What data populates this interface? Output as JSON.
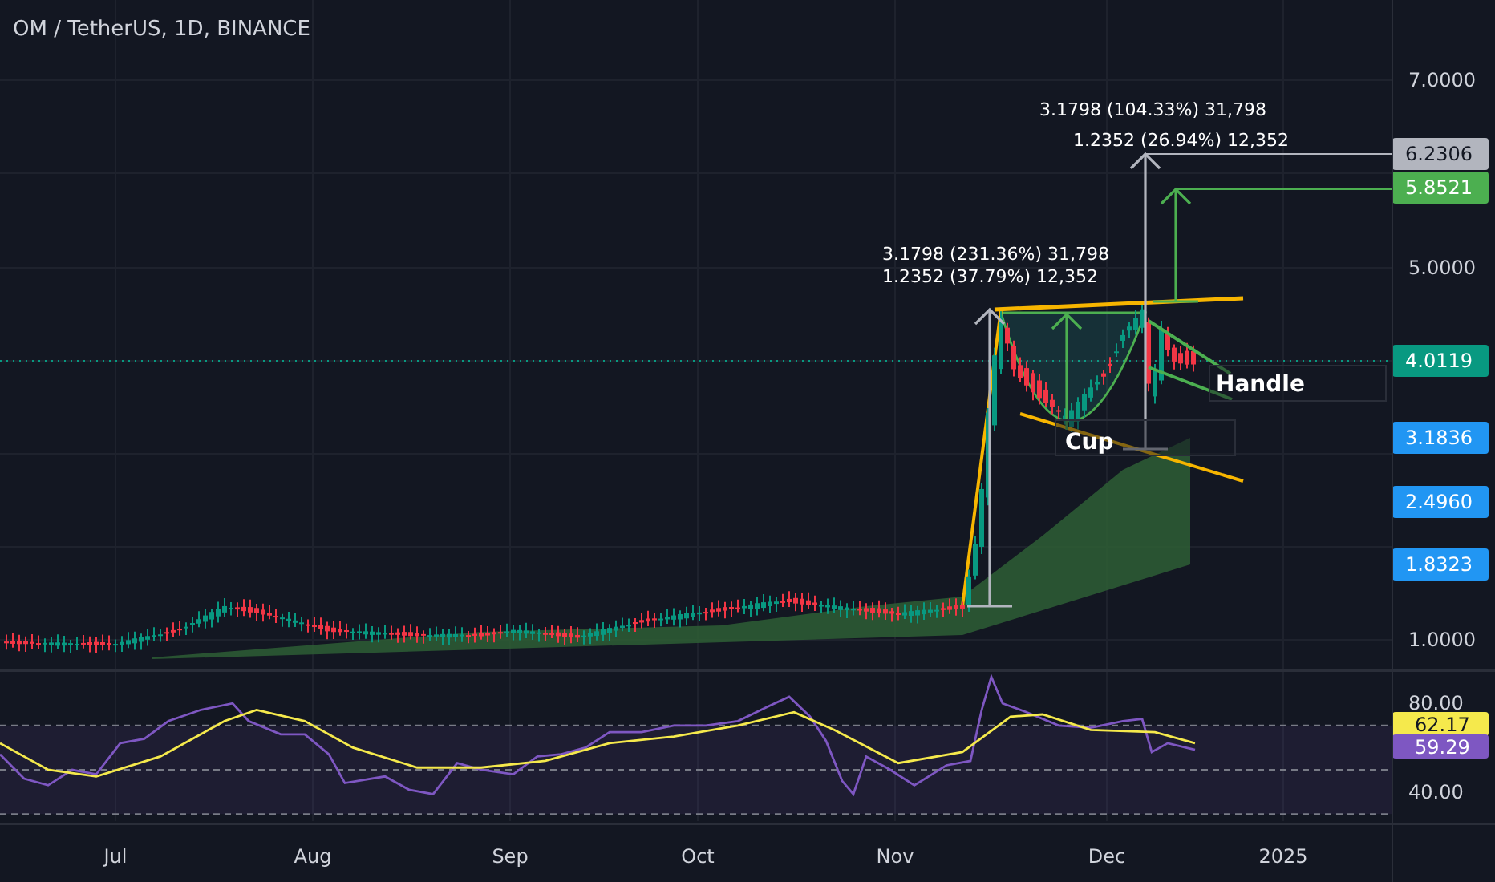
{
  "title": "OM / TetherUS, 1D, BINANCE",
  "price_axis": {
    "ticks": [
      "7.0000",
      "5.0000",
      "1.0000"
    ]
  },
  "price_tags": [
    {
      "text": "6.2306",
      "color": "#b2b5be"
    },
    {
      "text": "5.8521",
      "color": "#4caf50"
    },
    {
      "text": "4.0119",
      "color": "#089981"
    },
    {
      "text": "3.1836",
      "color": "#2196f3"
    },
    {
      "text": "2.4960",
      "color": "#2196f3"
    },
    {
      "text": "1.8323",
      "color": "#2196f3"
    }
  ],
  "measurements": [
    "3.1798 (104.33%) 31,798",
    "1.2352 (26.94%) 12,352",
    "3.1798 (231.36%) 31,798",
    "1.2352 (37.79%) 12,352"
  ],
  "pattern_labels": [
    "Cup",
    "Handle"
  ],
  "rsi": {
    "ticks": [
      "80.00",
      "40.00"
    ],
    "tags": [
      {
        "text": "62.17",
        "color": "#f5e94c"
      },
      {
        "text": "59.29",
        "color": "#7e57c2"
      }
    ]
  },
  "time_axis": [
    "Jul",
    "Aug",
    "Sep",
    "Oct",
    "Nov",
    "Dec",
    "2025"
  ]
}
